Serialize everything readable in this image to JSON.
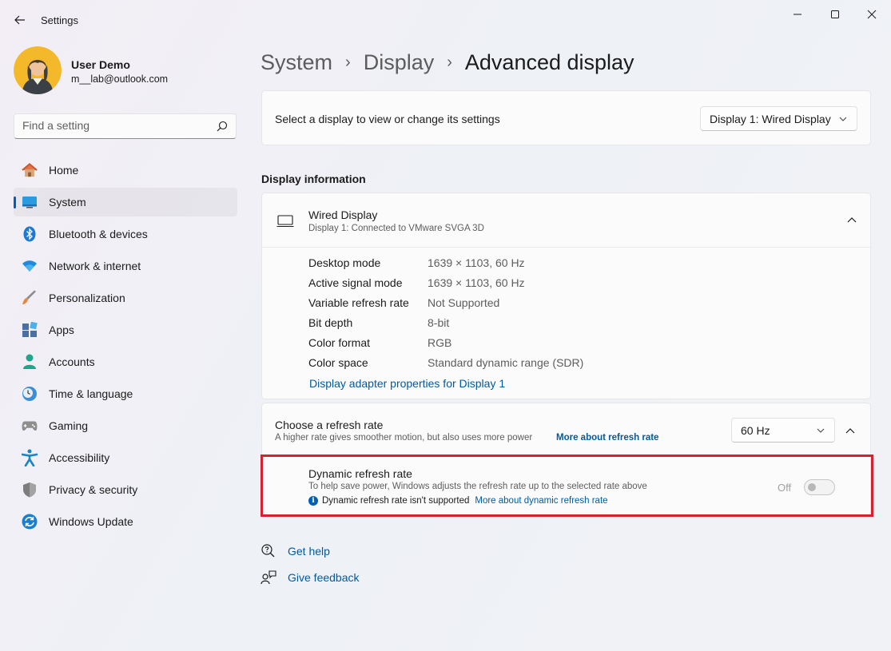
{
  "window": {
    "title": "Settings"
  },
  "user": {
    "name": "User Demo",
    "email": "m__lab@outlook.com"
  },
  "search": {
    "placeholder": "Find a setting"
  },
  "sidebar": {
    "items": [
      {
        "label": "Home",
        "icon": "home-icon"
      },
      {
        "label": "System",
        "icon": "system-icon",
        "active": true
      },
      {
        "label": "Bluetooth & devices",
        "icon": "bluetooth-icon"
      },
      {
        "label": "Network & internet",
        "icon": "wifi-icon"
      },
      {
        "label": "Personalization",
        "icon": "brush-icon"
      },
      {
        "label": "Apps",
        "icon": "apps-icon"
      },
      {
        "label": "Accounts",
        "icon": "person-icon"
      },
      {
        "label": "Time & language",
        "icon": "clock-globe-icon"
      },
      {
        "label": "Gaming",
        "icon": "gamepad-icon"
      },
      {
        "label": "Accessibility",
        "icon": "accessibility-icon"
      },
      {
        "label": "Privacy & security",
        "icon": "shield-icon"
      },
      {
        "label": "Windows Update",
        "icon": "update-icon"
      }
    ]
  },
  "breadcrumb": {
    "level1": "System",
    "level2": "Display",
    "current": "Advanced display",
    "separator": "›"
  },
  "display_select": {
    "label": "Select a display to view or change its settings",
    "selected": "Display 1: Wired Display"
  },
  "display_info": {
    "section_title": "Display information",
    "name": "Wired Display",
    "subtitle": "Display 1: Connected to VMware SVGA 3D",
    "rows": [
      {
        "key": "Desktop mode",
        "value": "1639 × 1103, 60 Hz"
      },
      {
        "key": "Active signal mode",
        "value": "1639 × 1103, 60 Hz"
      },
      {
        "key": "Variable refresh rate",
        "value": "Not Supported"
      },
      {
        "key": "Bit depth",
        "value": "8-bit"
      },
      {
        "key": "Color format",
        "value": "RGB"
      },
      {
        "key": "Color space",
        "value": "Standard dynamic range (SDR)"
      }
    ],
    "adapter_link": "Display adapter properties for Display 1"
  },
  "refresh": {
    "title": "Choose a refresh rate",
    "subtitle": "A higher rate gives smoother motion, but also uses more power",
    "more_link": "More about refresh rate",
    "selected": "60 Hz"
  },
  "dynamic_refresh": {
    "title": "Dynamic refresh rate",
    "subtitle": "To help save power, Windows adjusts the refresh rate up to the selected rate above",
    "note": "Dynamic refresh rate isn't supported",
    "more_link": "More about dynamic refresh rate",
    "toggle_label": "Off",
    "enabled": false
  },
  "help": {
    "get_help": "Get help",
    "give_feedback": "Give feedback"
  },
  "colors": {
    "accent": "#005fb8",
    "link": "#005a9e",
    "highlight_border": "#d62130"
  }
}
